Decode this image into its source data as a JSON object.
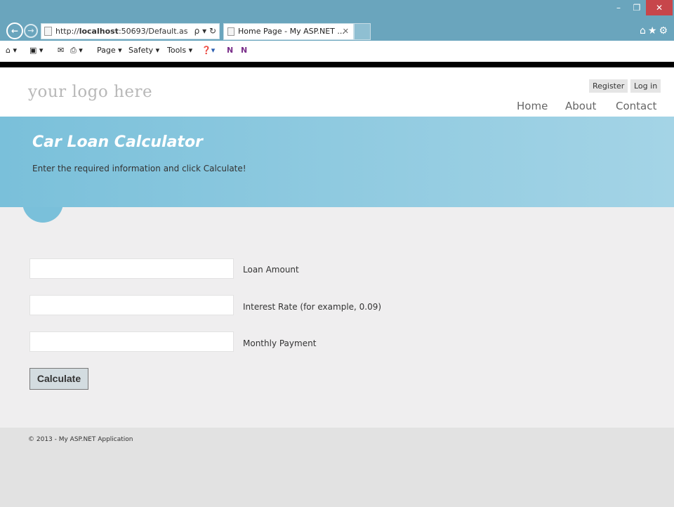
{
  "browser": {
    "address": "http://localhost:50693/Default.as",
    "address_url_prefix": "http://",
    "address_host": "localhost",
    "address_rest": ":50693/Default.as",
    "search_refresh": "ρ ▾ ↻",
    "tab_title": "Home Page - My ASP.NET ...",
    "tab_close": "✕",
    "back": "←",
    "forward": "→",
    "minimize": "–",
    "maximize": "❐",
    "close": "✕",
    "right_icons": "⌂★⚙",
    "commands": {
      "home": "⌂ ▾",
      "feeds": "▣ ▾",
      "mail": "✉",
      "print": "⎙ ▾",
      "page": "Page ▾",
      "safety": "Safety ▾",
      "tools": "Tools ▾",
      "help": "❓▾",
      "onenote1": "N",
      "onenote2": "N"
    }
  },
  "header": {
    "logo": "your logo here",
    "register": "Register",
    "login": "Log in",
    "nav": {
      "home": "Home",
      "about": "About",
      "contact": "Contact"
    }
  },
  "featured": {
    "title": "Car Loan Calculator",
    "text": "Enter the required information and click Calculate!"
  },
  "form": {
    "loan_amount_label": "Loan Amount",
    "loan_amount_value": "",
    "interest_rate_label": "Interest Rate (for example, 0.09)",
    "interest_rate_value": "",
    "monthly_payment_label": "Monthly Payment",
    "monthly_payment_value": "",
    "calculate_label": "Calculate"
  },
  "footer": {
    "text": "© 2013 - My ASP.NET Application"
  }
}
